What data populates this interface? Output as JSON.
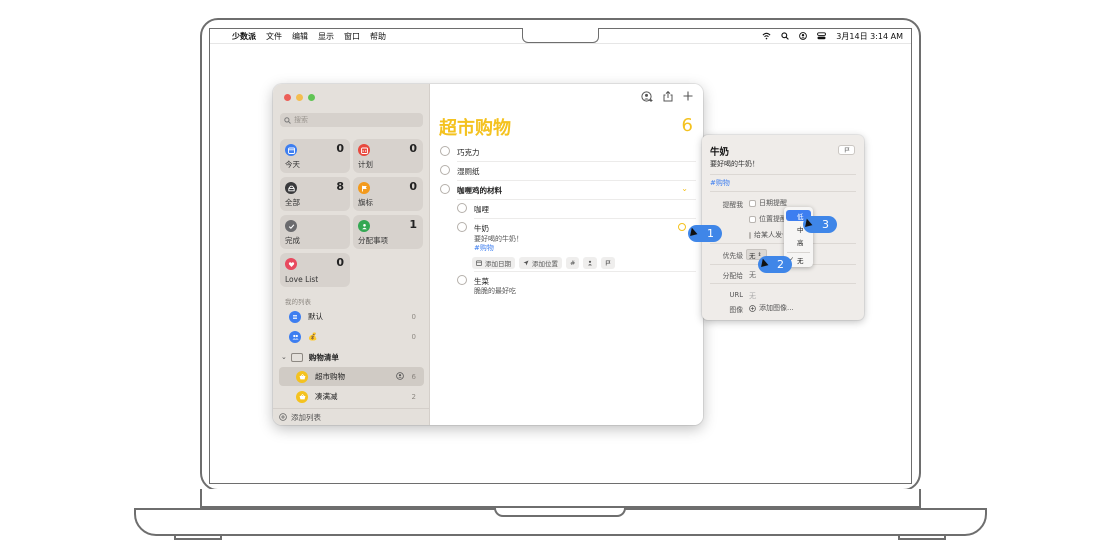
{
  "menubar": {
    "app_name": "少数派",
    "menus": [
      "文件",
      "编辑",
      "显示",
      "窗口",
      "帮助"
    ],
    "datetime": "3月14日 3:14 AM"
  },
  "sidebar": {
    "search_placeholder": "搜索",
    "smart_lists": [
      {
        "label": "今天",
        "count": "0",
        "icon": "calendar-icon",
        "color": "#3d7ef0"
      },
      {
        "label": "计划",
        "count": "0",
        "icon": "calendar-grid-icon",
        "color": "#e84a3f"
      },
      {
        "label": "全部",
        "count": "8",
        "icon": "tray-icon",
        "color": "#3a3a3c"
      },
      {
        "label": "旗标",
        "count": "0",
        "icon": "flag-icon",
        "color": "#f39a1c"
      },
      {
        "label": "完成",
        "count": "",
        "icon": "checkmark-icon",
        "color": "#6b6b6e"
      },
      {
        "label": "分配事项",
        "count": "1",
        "icon": "person-icon",
        "color": "#34a853"
      },
      {
        "label": "Love List",
        "count": "0",
        "icon": "heart-icon",
        "color": "#e84a5f"
      }
    ],
    "section_title": "我的列表",
    "lists": [
      {
        "label": "默认",
        "count": "0",
        "color": "#3d7ef0"
      },
      {
        "label": "💰",
        "count": "0",
        "color": "#3d7ef0"
      }
    ],
    "group": {
      "label": "购物清单"
    },
    "group_lists": [
      {
        "label": "超市购物",
        "count": "6",
        "color": "#f4c21f"
      },
      {
        "label": "凑满减",
        "count": "2",
        "color": "#f4c21f"
      }
    ],
    "add_list_label": "添加列表"
  },
  "main": {
    "title": "超市购物",
    "count": "6",
    "tasks": [
      {
        "title": "巧克力"
      },
      {
        "title": "湿厕纸"
      },
      {
        "title": "咖喱鸡的材料"
      }
    ],
    "subtasks": [
      {
        "title": "咖哩"
      },
      {
        "title": "牛奶",
        "note": "要好喝的牛奶！",
        "tag": "#购物"
      },
      {
        "title": "生菜",
        "note": "脆脆的最好吃"
      }
    ],
    "chips": {
      "add_date": "添加日期",
      "add_location": "添加位置",
      "hash": "#"
    }
  },
  "popover": {
    "title": "牛奶",
    "note": "要好喝的牛奶！",
    "tag": "#购物",
    "remind_label": "提醒我",
    "remind_options": [
      "日期提醒",
      "位置提醒",
      "给某人发信息时"
    ],
    "priority_label": "优先级",
    "priority_value": "无",
    "assign_label": "分配给",
    "assign_value": "无",
    "url_label": "URL",
    "url_value": "无",
    "image_label": "图像",
    "add_image": "添加图像..."
  },
  "priority_menu": {
    "items": [
      "低",
      "中",
      "高"
    ],
    "none_item": "无"
  },
  "callouts": [
    "1",
    "2",
    "3"
  ]
}
